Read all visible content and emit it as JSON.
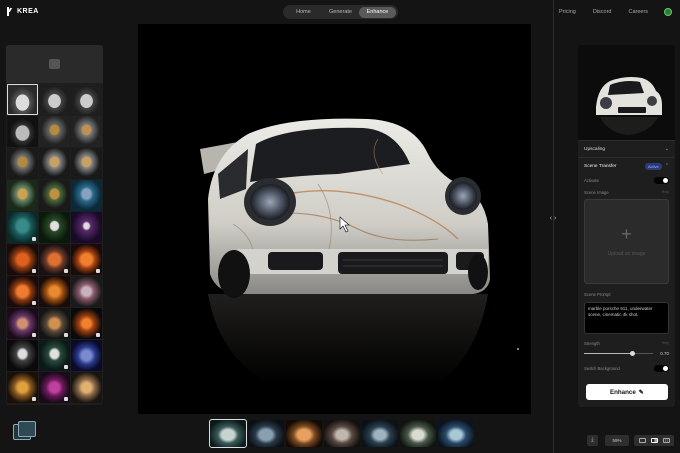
{
  "app": {
    "name": "KREA"
  },
  "nav": {
    "tabs": [
      {
        "label": "Home"
      },
      {
        "label": "Generate"
      },
      {
        "label": "Enhance"
      }
    ],
    "active_tab": "Enhance",
    "links": [
      {
        "label": "Pricing"
      },
      {
        "label": "Discord"
      },
      {
        "label": "Careers"
      }
    ]
  },
  "panel": {
    "upscaling_label": "Upscaling",
    "scene_transfer": {
      "label": "Scene Transfer",
      "status": "Active",
      "activate_label": "Activate",
      "activate_on": true,
      "scene_image_label": "Scene Image",
      "scene_image_hint": "Help",
      "upload_label": "Upload an image",
      "scene_prompt_label": "Scene Prompt",
      "scene_prompt_value": "marble porsche 911, underwater scene, cinematic 4k shot.",
      "strength_label": "Strength",
      "strength_hint": "Help",
      "strength_value": 0.7,
      "strength_display": "0.70",
      "switch_background_label": "Switch Background",
      "switch_background_on": true
    },
    "enhance_button": "Enhance",
    "enhance_icon": "sparkle-icon"
  },
  "footer": {
    "zoom": "59%",
    "download_icon": "download-icon"
  },
  "colors": {
    "background": "#141414",
    "panel": "#1e1e1e",
    "active_tab": "#5a5a5a",
    "accent_badge": "#2c3a7a"
  }
}
